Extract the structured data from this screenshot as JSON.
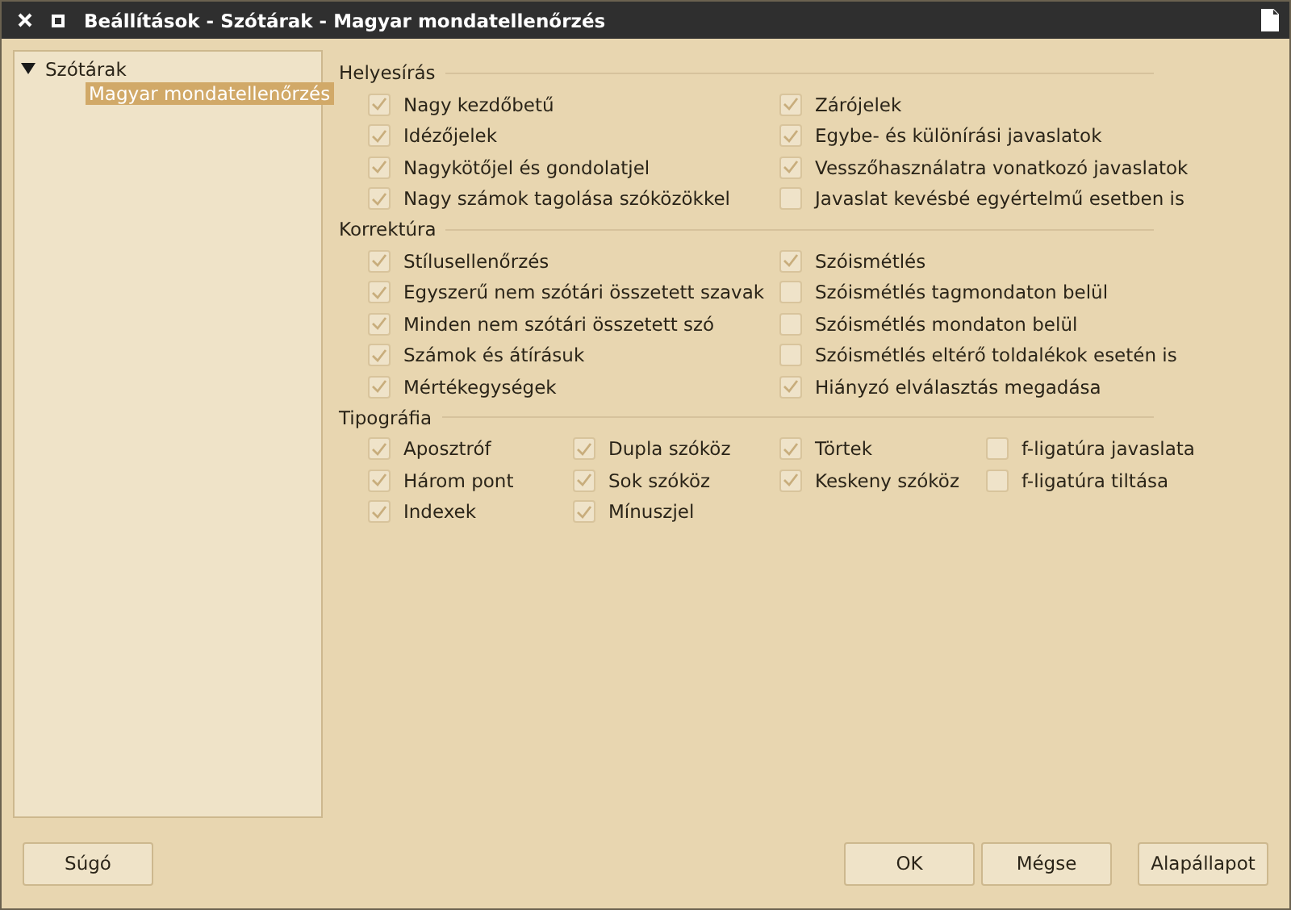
{
  "window": {
    "title": "Beállítások - Szótárak - Magyar mondatellenőrzés"
  },
  "tree": [
    {
      "label": "Szótárak",
      "expanded": true,
      "selected": false,
      "children": [
        {
          "label": "Magyar mondatellenőrzés",
          "selected": true
        }
      ]
    }
  ],
  "sections": [
    {
      "title": "Helyesírás",
      "columns": [
        [
          {
            "label": "Nagy kezdőbetű",
            "checked": true
          },
          {
            "label": "Idézőjelek",
            "checked": true
          },
          {
            "label": "Nagykötőjel és gondolatjel",
            "checked": true
          },
          {
            "label": "Nagy számok tagolása szóközökkel",
            "checked": true
          }
        ],
        [
          {
            "label": "Zárójelek",
            "checked": true
          },
          {
            "label": "Egybe- és különírási javaslatok",
            "checked": true
          },
          {
            "label": "Vesszőhasználatra vonatkozó javaslatok",
            "checked": true
          },
          {
            "label": "Javaslat kevésbé egyértelmű esetben is",
            "checked": false
          }
        ]
      ]
    },
    {
      "title": "Korrektúra",
      "columns": [
        [
          {
            "label": "Stílusellenőrzés",
            "checked": true
          },
          {
            "label": "Egyszerű nem szótári összetett szavak",
            "checked": true
          },
          {
            "label": "Minden nem szótári összetett szó",
            "checked": true
          },
          {
            "label": "Számok és átírásuk",
            "checked": true
          },
          {
            "label": "Mértékegységek",
            "checked": true
          }
        ],
        [
          {
            "label": "Szóismétlés",
            "checked": true
          },
          {
            "label": "Szóismétlés tagmondaton belül",
            "checked": false
          },
          {
            "label": "Szóismétlés mondaton belül",
            "checked": false
          },
          {
            "label": "Szóismétlés eltérő toldalékok esetén is",
            "checked": false
          },
          {
            "label": "Hiányzó elválasztás megadása",
            "checked": true
          }
        ]
      ]
    },
    {
      "title": "Tipográfia",
      "columns": [
        [
          {
            "label": "Aposztróf",
            "checked": true
          },
          {
            "label": "Három pont",
            "checked": true
          },
          {
            "label": "Indexek",
            "checked": true
          }
        ],
        [
          {
            "label": "Dupla szóköz",
            "checked": true
          },
          {
            "label": "Sok szóköz",
            "checked": true
          },
          {
            "label": "Mínuszjel",
            "checked": true
          }
        ],
        [
          {
            "label": "Törtek",
            "checked": true
          },
          {
            "label": "Keskeny szóköz",
            "checked": true
          }
        ],
        [
          {
            "label": "f-ligatúra javaslata",
            "checked": false
          },
          {
            "label": "f-ligatúra tiltása",
            "checked": false
          }
        ]
      ]
    }
  ],
  "buttons_left": [
    "Súgó"
  ],
  "buttons_right": [
    "OK",
    "Mégse",
    "Alapállapot"
  ]
}
